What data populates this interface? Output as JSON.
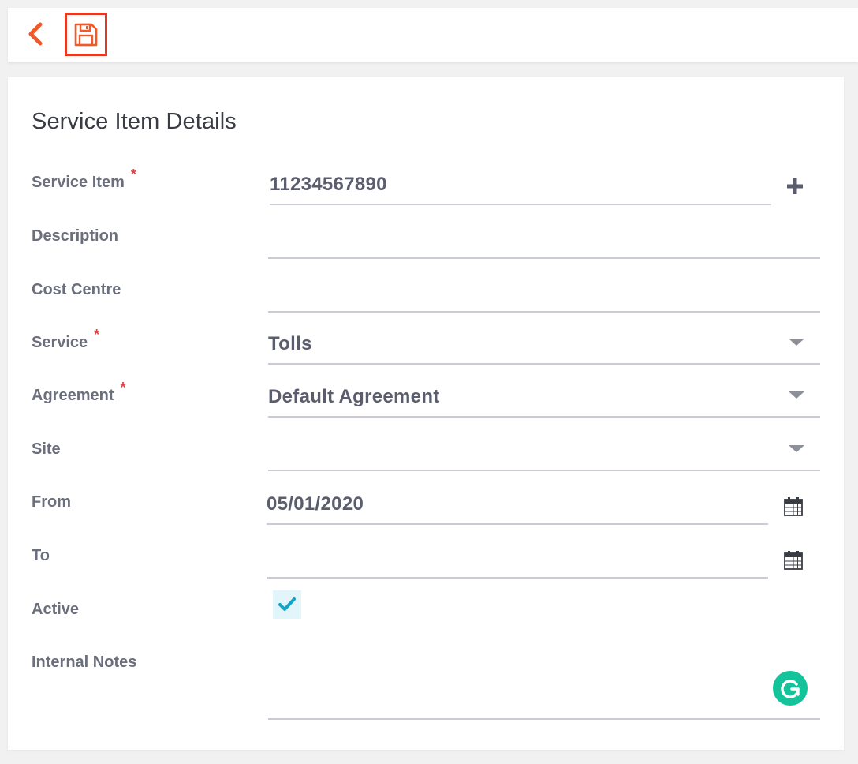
{
  "toolbar": {
    "back_icon": "chevron-left-icon",
    "save_icon": "floppy-disk-icon",
    "accent_color": "#f05a28",
    "save_highlight_color": "#e03c25"
  },
  "form": {
    "title": "Service Item Details",
    "required_marker": "*",
    "fields": {
      "service_item": {
        "label": "Service Item",
        "value": "11234567890",
        "required": true
      },
      "description": {
        "label": "Description",
        "value": ""
      },
      "cost_centre": {
        "label": "Cost Centre",
        "value": ""
      },
      "service": {
        "label": "Service",
        "value": "Tolls",
        "required": true
      },
      "agreement": {
        "label": "Agreement",
        "value": "Default Agreement",
        "required": true
      },
      "site": {
        "label": "Site",
        "value": ""
      },
      "from": {
        "label": "From",
        "value": "05/01/2020"
      },
      "to": {
        "label": "To",
        "value": ""
      },
      "active": {
        "label": "Active",
        "checked": true
      },
      "internal_notes": {
        "label": "Internal Notes",
        "value": ""
      }
    }
  },
  "colors": {
    "required": "#d94545",
    "checkbox_check": "#0ea5c6",
    "grammarly": "#15c39a"
  }
}
